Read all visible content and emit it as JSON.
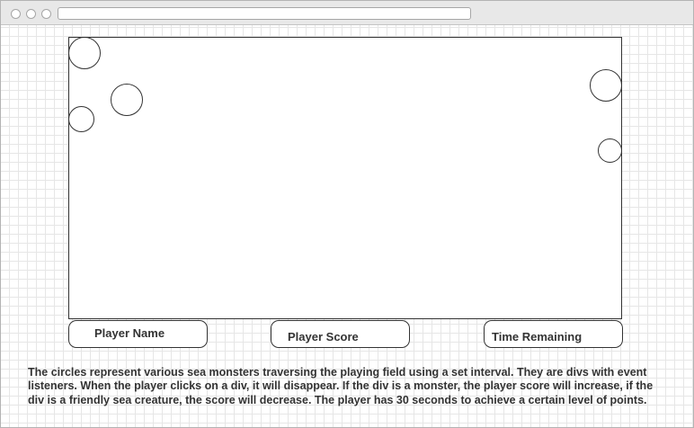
{
  "browser": {
    "url": ""
  },
  "game": {
    "creature_count": 5,
    "player_name_label": "Player Name",
    "player_score_label": "Player Score",
    "time_remaining_label": "Time Remaining"
  },
  "description": "The circles represent various sea monsters traversing the playing field using a set interval. They are divs with event listeners. When the player clicks on a div, it will disappear. If the div is a monster, the player score will increase, if the div is a friendly sea creature, the score will decrease. The player has 30 seconds to achieve a certain level of points."
}
